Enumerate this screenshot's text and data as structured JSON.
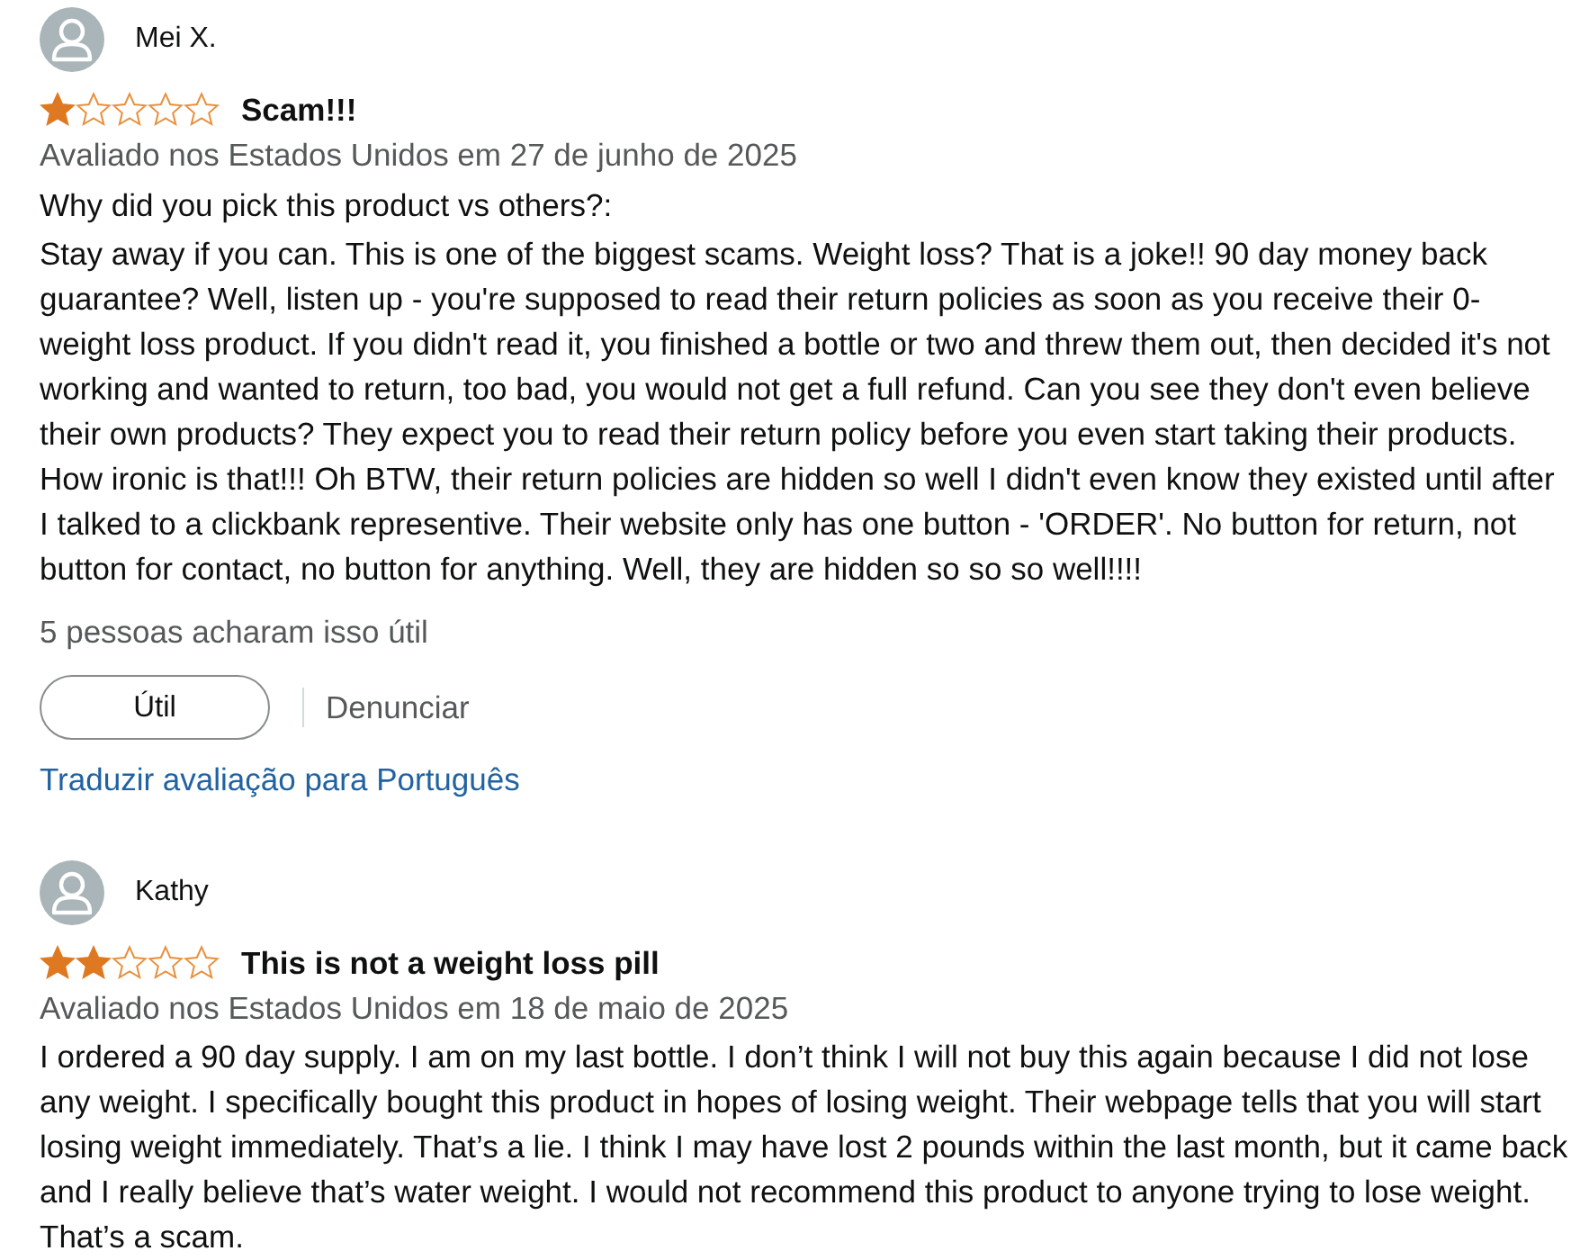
{
  "reviews": [
    {
      "author": "Mei X.",
      "stars": 1,
      "title": "Scam!!!",
      "date_line": "Avaliado nos Estados Unidos em 27 de junho de 2025",
      "question": "Why did you pick this product vs others?:",
      "body": "Stay away if you can. This is one of the biggest scams. Weight loss? That is a joke!! 90 day money back guarantee? Well, listen up - you're supposed to read their return policies as soon as you receive their 0-weight loss product. If you didn't read it, you finished a bottle or two and threw them out, then decided it's not working and wanted to return, too bad, you would not get a full refund. Can you see they don't even believe their own products? They expect you to read their return policy before you even start taking their products. How ironic is that!!! Oh BTW, their return policies are hidden so well I didn't even know they existed until after I talked to a clickbank representive. Their website only has one button - 'ORDER'. No button for return, not button for contact, no button for anything. Well, they are hidden so so so well!!!!",
      "helpful_count": "5 pessoas acharam isso útil",
      "helpful_button": "Útil",
      "report_link": "Denunciar",
      "translate_link": "Traduzir avaliação para Português"
    },
    {
      "author": "Kathy",
      "stars": 2,
      "title": "This is not a weight loss pill",
      "date_line": "Avaliado nos Estados Unidos em 18 de maio de 2025",
      "body": "I ordered a 90 day supply. I am on my last bottle. I don’t think I will not buy this again because I did not lose any weight. I specifically bought this product in hopes of losing weight. Their webpage tells that you will start losing weight immediately. That’s a lie. I think I may have lost 2 pounds within the last month, but it came back and I really believe that’s water weight. I would not recommend this product to anyone trying to lose weight. That’s a scam."
    }
  ]
}
